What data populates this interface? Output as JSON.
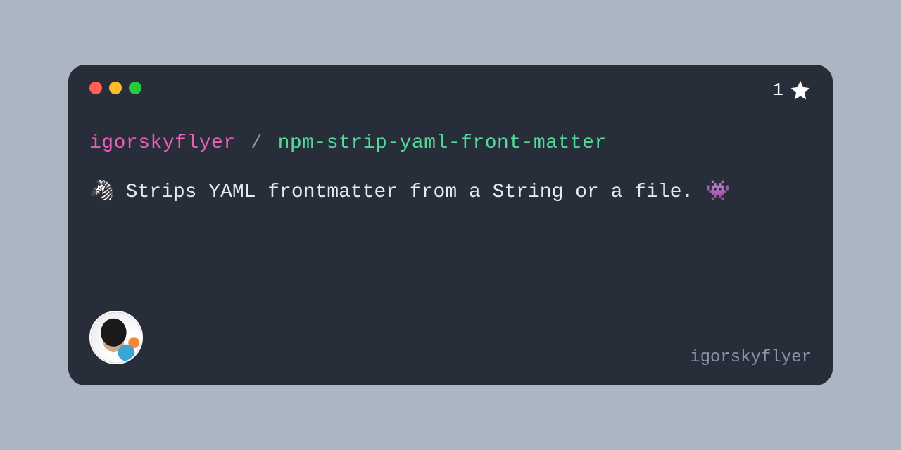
{
  "repo": {
    "owner": "igorskyflyer",
    "separator": "/",
    "name": "npm-strip-yaml-front-matter",
    "description": "🦓 Strips YAML frontmatter from a String or a file. 👾",
    "stars": "1"
  },
  "footer": {
    "username": "igorskyflyer"
  }
}
